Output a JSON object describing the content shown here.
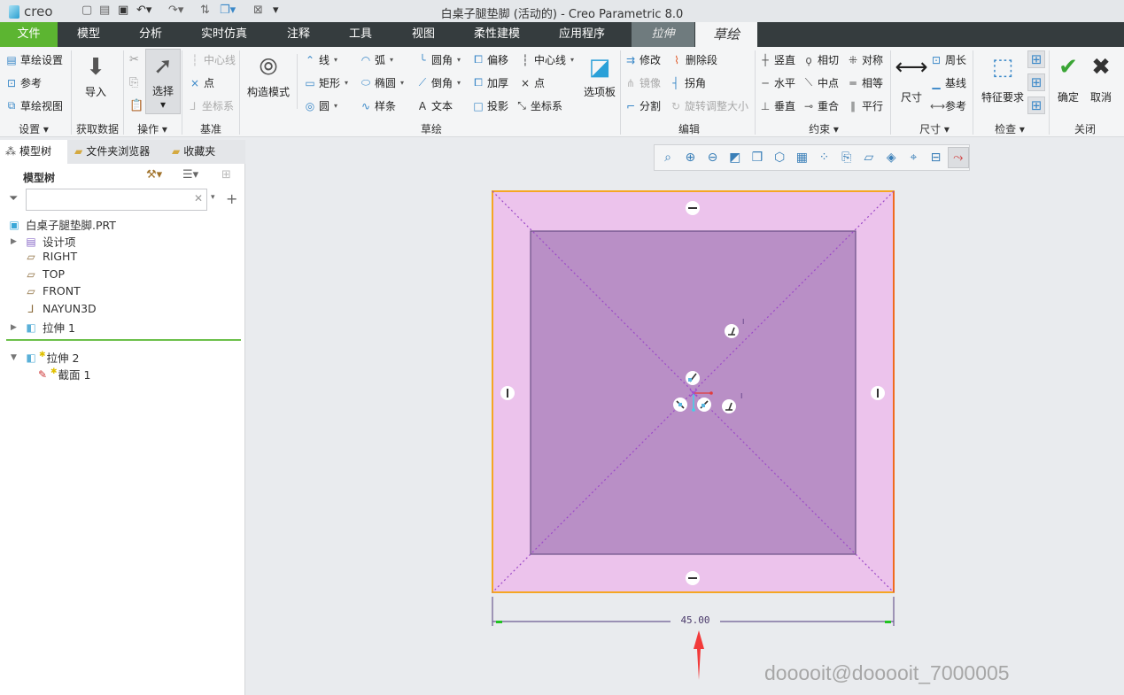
{
  "app": {
    "logo": "creo",
    "window_title": "白桌子腿垫脚 (活动的) - Creo Parametric 8.0"
  },
  "quick_access": [
    "new-icon",
    "open-icon",
    "save-icon",
    "undo-icon",
    "redo-icon",
    "regenerate-icon",
    "windows-icon",
    "close-window-icon",
    "customize-icon"
  ],
  "menu": {
    "tabs": [
      "文件",
      "模型",
      "分析",
      "实时仿真",
      "注释",
      "工具",
      "视图",
      "柔性建模",
      "应用程序",
      "拉伸",
      "草绘"
    ],
    "active": "草绘"
  },
  "ribbon": {
    "groups": [
      "设置 ▾",
      "获取数据",
      "操作 ▾",
      "基准",
      "草绘",
      "编辑",
      "约束 ▾",
      "尺寸 ▾",
      "检查 ▾",
      "关闭"
    ],
    "items": {
      "sketch_setup": "草绘设置",
      "references": "参考",
      "sketch_view": "草绘视图",
      "import": "导入",
      "select": "选择",
      "centerline_datum": "中心线",
      "point_datum": "点",
      "csys_datum": "坐标系",
      "construction_mode": "构造模式",
      "line": "线",
      "rectangle": "矩形",
      "circle": "圆",
      "arc": "弧",
      "ellipse": "椭圆",
      "spline": "样条",
      "fillet": "圆角",
      "chamfer": "倒角",
      "text": "文本",
      "offset": "偏移",
      "thicken": "加厚",
      "project": "投影",
      "centerline": "中心线",
      "point": "点",
      "csys": "坐标系",
      "palette": "选项板",
      "modify": "修改",
      "mirror": "镜像",
      "divide": "分割",
      "delete_segment": "删除段",
      "corner": "拐角",
      "rotate_resize": "旋转调整大小",
      "vertical": "竖直",
      "horizontal": "水平",
      "perpendicular": "垂直",
      "tangent": "相切",
      "midpoint": "中点",
      "coincident": "重合",
      "symmetric": "对称",
      "equal": "相等",
      "parallel": "平行",
      "dimension": "尺寸",
      "perimeter": "周长",
      "baseline": "基线",
      "reference": "参考",
      "feature_requirements": "特征要求",
      "ok": "确定",
      "cancel": "取消"
    }
  },
  "left_panel": {
    "tabs": [
      "模型树",
      "文件夹浏览器",
      "收藏夹"
    ],
    "header": "模型树",
    "search": {
      "value": "",
      "placeholder": ""
    },
    "tree": [
      {
        "label": "白桌子腿垫脚.PRT",
        "icon": "part-icon"
      },
      {
        "label": "设计项",
        "icon": "design-items-icon",
        "expandable": true
      },
      {
        "label": "RIGHT",
        "icon": "datum-plane-icon"
      },
      {
        "label": "TOP",
        "icon": "datum-plane-icon"
      },
      {
        "label": "FRONT",
        "icon": "datum-plane-icon"
      },
      {
        "label": "NAYUN3D",
        "icon": "csys-icon"
      },
      {
        "label": "拉伸 1",
        "icon": "extrude-icon",
        "expandable": true
      },
      {
        "label": "拉伸 2",
        "icon": "extrude-icon",
        "expanded": true
      },
      {
        "label": "截面 1",
        "icon": "sketch-icon"
      }
    ]
  },
  "view_toolbar": [
    "refit-icon",
    "zoom-in-icon",
    "zoom-out-icon",
    "repaint-icon",
    "display-style-icon",
    "saved-orientations-icon",
    "view-manager-icon",
    "datum-display-icon",
    "annotation-display-icon",
    "sketch-view-icon",
    "perspective-icon",
    "spin-center-icon",
    "sketcher-display-icon",
    "constraint-display-icon"
  ],
  "sketch": {
    "dimension": "45.00",
    "colors": {
      "outer_fill": "#ecc3ec",
      "inner_fill": "#b98fc6",
      "edge": "#f5a623",
      "dimension": "#6b5a91"
    }
  },
  "watermark": "dooooit@dooooit_7000005"
}
